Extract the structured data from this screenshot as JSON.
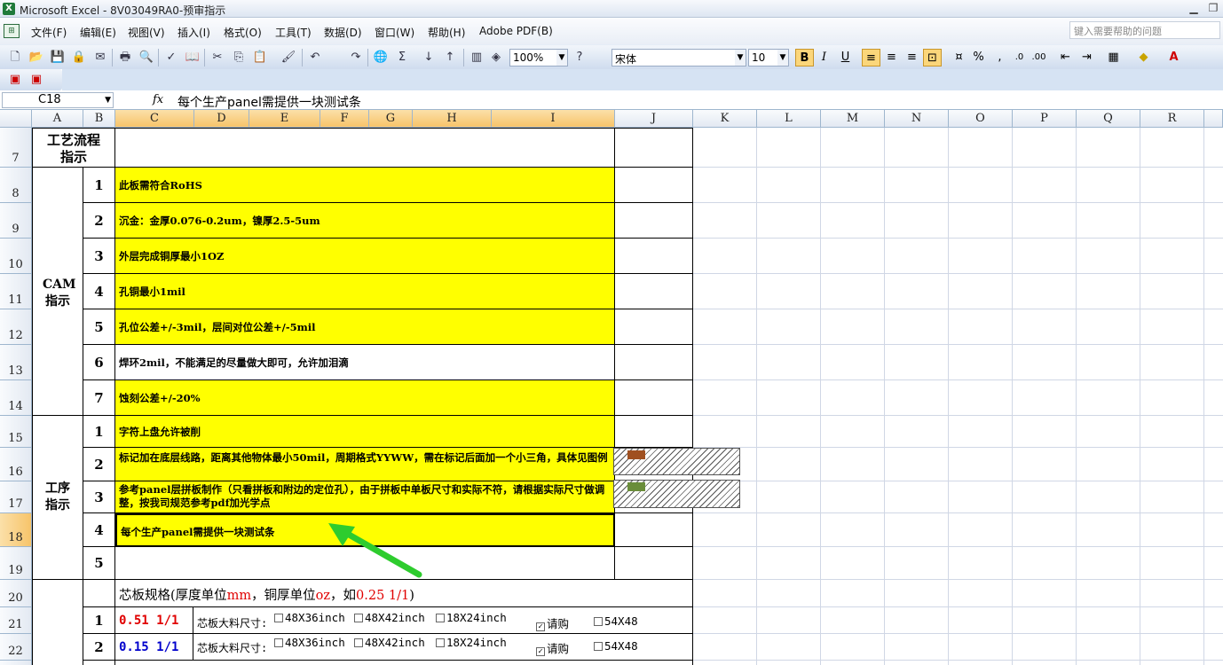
{
  "window": {
    "title": "Microsoft Excel - 8V03049RA0-预审指示"
  },
  "menu": [
    "文件(F)",
    "编辑(E)",
    "视图(V)",
    "插入(I)",
    "格式(O)",
    "工具(T)",
    "数据(D)",
    "窗口(W)",
    "帮助(H)",
    "Adobe PDF(B)"
  ],
  "help_placeholder": "键入需要帮助的问题",
  "toolbar": {
    "zoom": "100%",
    "font": "宋体",
    "size": "10",
    "bold": "B",
    "italic": "I",
    "underline": "U",
    "sum": "Σ",
    "percent": "%"
  },
  "namebox": "C18",
  "formula": "每个生产panel需提供一块测试条",
  "columns": [
    "A",
    "B",
    "C",
    "D",
    "E",
    "F",
    "G",
    "H",
    "I",
    "J",
    "K",
    "L",
    "M",
    "N",
    "O",
    "P",
    "Q",
    "R"
  ],
  "rows": [
    "7",
    "8",
    "9",
    "10",
    "11",
    "12",
    "13",
    "14",
    "15",
    "16",
    "17",
    "18",
    "19",
    "20",
    "21",
    "22"
  ],
  "sheet": {
    "row7_label": "工艺流程指示",
    "cam_label": "CAM指示",
    "proc_label": "工序指示",
    "cam_items": [
      {
        "n": "1",
        "text": "此板需符合RoHS"
      },
      {
        "n": "2",
        "text": "沉金：金厚0.076-0.2um，镍厚2.5-5um"
      },
      {
        "n": "3",
        "text": "外层完成铜厚最小1OZ"
      },
      {
        "n": "4",
        "text": "孔铜最小1mil"
      },
      {
        "n": "5",
        "text": "孔位公差+/-3mil，层间对位公差+/-5mil"
      },
      {
        "n": "6",
        "text": "焊环2mil，不能满足的尽量做大即可，允许加泪滴"
      },
      {
        "n": "7",
        "text": "蚀刻公差+/-20%"
      }
    ],
    "proc_items": [
      {
        "n": "1",
        "text": "字符上盘允许被削"
      },
      {
        "n": "2",
        "text": "标记加在底层线路，距离其他物体最小50mil，周期格式YYWW，需在标记后面加一个小三角，具体见图例"
      },
      {
        "n": "3",
        "text": "参考panel层拼板制作（只看拼板和附边的定位孔），由于拼板中单板尺寸和实际不符，请根据实际尺寸做调整，按我司规范参考pdf加光学点"
      },
      {
        "n": "4",
        "text": "每个生产panel需提供一块测试条"
      },
      {
        "n": "5",
        "text": ""
      }
    ],
    "core_title_a": "芯板规格(厚度单位",
    "core_title_mm": "mm",
    "core_title_b": "，铜厚单位",
    "core_title_oz": "oz",
    "core_title_c": "，如",
    "core_title_eg": "0.25 1/1",
    "core_title_d": ")",
    "core_rows": [
      {
        "n": "1",
        "spec": "0.51 1/1",
        "color": "#e00000"
      },
      {
        "n": "2",
        "spec": "0.15 1/1",
        "color": "#0000cc"
      }
    ],
    "size_label": "芯板大料尺寸:",
    "size_options": [
      "48X36inch",
      "48X42inch",
      "18X24inch",
      "请购",
      "54X48"
    ]
  }
}
